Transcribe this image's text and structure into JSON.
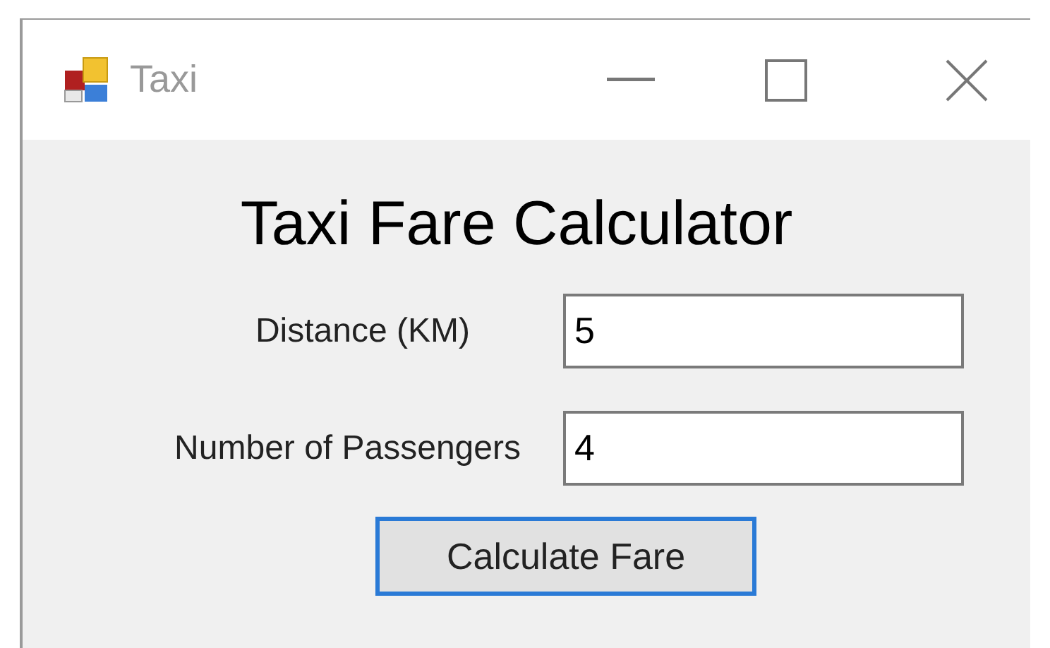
{
  "window": {
    "title": "Taxi"
  },
  "heading": "Taxi Fare Calculator",
  "fields": [
    {
      "label": "Distance (KM)",
      "value": "5"
    },
    {
      "label": "Number of Passengers",
      "value": "4"
    }
  ],
  "button": {
    "label": "Calculate Fare",
    "focused": true
  }
}
